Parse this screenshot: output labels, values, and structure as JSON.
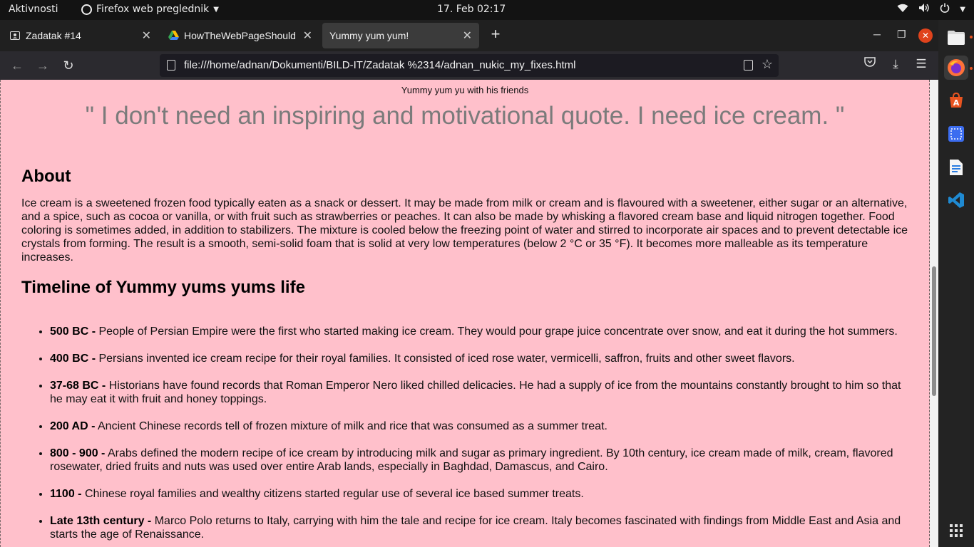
{
  "topbar": {
    "activities": "Aktivnosti",
    "app_name": "Firefox web preglednik",
    "clock": "17. Feb  02:17"
  },
  "tabs": [
    {
      "label": "Zadatak #14",
      "icon": "person-card-icon"
    },
    {
      "label": "HowTheWebPageShould",
      "icon": "google-drive-icon"
    },
    {
      "label": "Yummy yum yum!",
      "active": true
    }
  ],
  "navbar": {
    "url": "file:///home/adnan/Dokumenti/BILD-IT/Zadatak %2314/adnan_nukic_my_fixes.html"
  },
  "page": {
    "caption": "Yummy yum yu with his friends",
    "quote": "\" I don't need an inspiring and motivational quote. I need ice cream. \"",
    "about_heading": "About",
    "about_text": "Ice cream is a sweetened frozen food typically eaten as a snack or dessert. It may be made from milk or cream and is flavoured with a sweetener, either sugar or an alternative, and a spice, such as cocoa or vanilla, or with fruit such as strawberries or peaches. It can also be made by whisking a flavored cream base and liquid nitrogen together. Food coloring is sometimes added, in addition to stabilizers. The mixture is cooled below the freezing point of water and stirred to incorporate air spaces and to prevent detectable ice crystals from forming. The result is a smooth, semi-solid foam that is solid at very low temperatures (below 2 °C or 35 °F). It becomes more malleable as its temperature increases.",
    "timeline_heading": "Timeline of Yummy yums yums life",
    "timeline": [
      {
        "year": "500 BC -",
        "text": "People of Persian Empire were the first who started making ice cream. They would pour grape juice concentrate over snow, and eat it during the hot summers."
      },
      {
        "year": "400 BC -",
        "text": "Persians invented ice cream recipe for their royal families. It consisted of iced rose water, vermicelli, saffron, fruits and other sweet flavors."
      },
      {
        "year": "37-68 BC -",
        "text": "Historians have found records that Roman Emperor Nero liked chilled delicacies. He had a supply of ice from the mountains constantly brought to him so that he may eat it with fruit and honey toppings."
      },
      {
        "year": "200 AD -",
        "text": "Ancient Chinese records tell of frozen mixture of milk and rice that was consumed as a summer treat."
      },
      {
        "year": "800 - 900 -",
        "text": "Arabs defined the modern recipe of ice cream by introducing milk and sugar as primary ingredient. By 10th century, ice cream made of milk, cream, flavored rosewater, dried fruits and nuts was used over entire Arab lands, especially in Baghdad, Damascus, and Cairo."
      },
      {
        "year": "1100 -",
        "text": "Chinese royal families and wealthy citizens started regular use of several ice based summer treats."
      },
      {
        "year": "Late 13th century -",
        "text": "Marco Polo returns to Italy, carrying with him the tale and recipe for ice cream. Italy becomes fascinated with findings from Middle East and Asia and starts the age of Renaissance."
      }
    ]
  },
  "dock": [
    {
      "icon": "files-icon",
      "color": "#9a9a9a"
    },
    {
      "icon": "firefox-icon",
      "color": "#ff7139"
    },
    {
      "icon": "software-store-icon",
      "color": "#e95420"
    },
    {
      "icon": "screenshot-icon",
      "color": "#3c6df0"
    },
    {
      "icon": "text-document-icon",
      "color": "#2a7de1"
    },
    {
      "icon": "vscode-icon",
      "color": "#1f8ad2"
    },
    {
      "icon": "app-grid-icon",
      "color": "#e0e0e0"
    }
  ],
  "colors": {
    "page_bg": "#ffc0cb",
    "quote": "#7b7b7b",
    "accent": "#e95420"
  }
}
